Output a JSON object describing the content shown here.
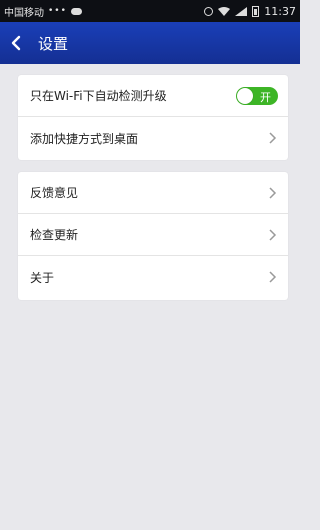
{
  "status_bar": {
    "carrier": "中国移动",
    "dots": "•••",
    "time": "11:37"
  },
  "header": {
    "title": "设置"
  },
  "groups": [
    {
      "items": [
        {
          "label": "只在Wi-Fi下自动检测升级",
          "control": "toggle",
          "toggle_text": "开",
          "on": true
        },
        {
          "label": "添加快捷方式到桌面",
          "control": "chevron"
        }
      ]
    },
    {
      "items": [
        {
          "label": "反馈意见",
          "control": "chevron"
        },
        {
          "label": "检查更新",
          "control": "chevron"
        },
        {
          "label": "关于",
          "control": "chevron"
        }
      ]
    }
  ],
  "colors": {
    "header": "#1a3fb8",
    "toggle_on": "#3db526",
    "background": "#e8e8ec"
  }
}
